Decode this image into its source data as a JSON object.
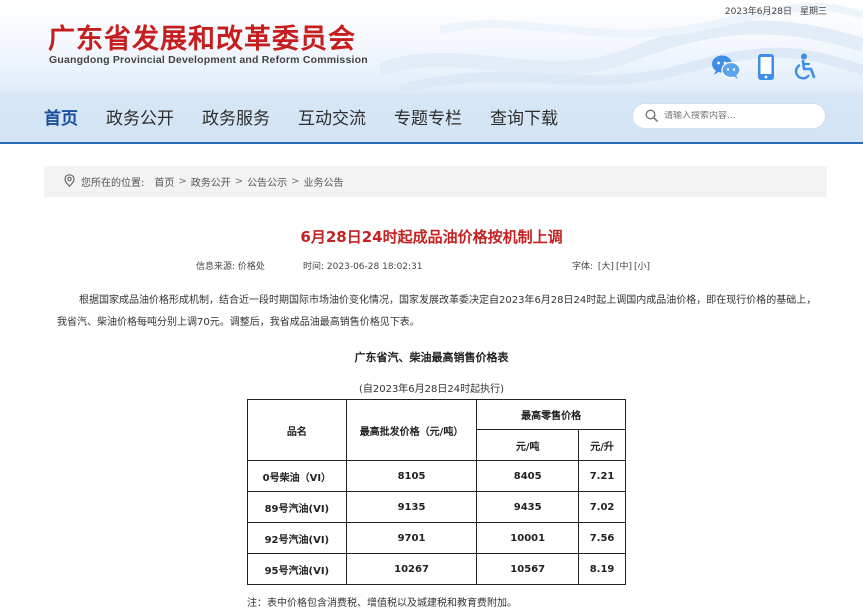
{
  "header": {
    "date": "2023年6月28日",
    "weekday": "星期三",
    "title_cn": "广东省发展和改革委员会",
    "title_en": "Guangdong Provincial Development and Reform Commission",
    "icons": [
      "wechat-icon",
      "mobile-icon",
      "accessibility-icon"
    ]
  },
  "nav": {
    "items": [
      "首页",
      "政务公开",
      "政务服务",
      "互动交流",
      "专题专栏",
      "查询下载"
    ],
    "active_index": 0
  },
  "search": {
    "placeholder": "请输入搜索内容..."
  },
  "breadcrumb": {
    "label": "您所在的位置:",
    "items": [
      "首页",
      "政务公开",
      "公告公示",
      "业务公告"
    ]
  },
  "article": {
    "title": "6月28日24时起成品油价格按机制上调",
    "source_label": "信息来源:",
    "source_value": "价格处",
    "time_label": "时间:",
    "time_value": "2023-06-28 18:02:31",
    "font_label": "字体:",
    "font_sizes": [
      "[大]",
      "[中]",
      "[小]"
    ],
    "paragraph": "根据国家成品油价格形成机制，结合近一段时期国际市场油价变化情况，国家发展改革委决定自2023年6月28日24时起上调国内成品油价格，即在现行价格的基础上，我省汽、柴油价格每吨分别上调70元。调整后，我省成品油最高销售价格见下表。",
    "table_title": "广东省汽、柴油最高销售价格表",
    "table_subtitle": "(自2023年6月28日24时起执行)",
    "table": {
      "header": {
        "product": "品名",
        "wholesale": "最高批发价格（元/吨）",
        "retail": "最高零售价格",
        "retail_ton": "元/吨",
        "retail_liter": "元/升"
      },
      "rows": [
        {
          "product": "0号柴油（VI）",
          "wholesale": "8105",
          "retail_ton": "8405",
          "retail_liter": "7.21"
        },
        {
          "product": "89号汽油(VI)",
          "wholesale": "9135",
          "retail_ton": "9435",
          "retail_liter": "7.02"
        },
        {
          "product": "92号汽油(VI)",
          "wholesale": "9701",
          "retail_ton": "10001",
          "retail_liter": "7.56"
        },
        {
          "product": "95号汽油(VI)",
          "wholesale": "10267",
          "retail_ton": "10567",
          "retail_liter": "8.19"
        }
      ]
    },
    "note": "注：表中价格包含消费税、增值税以及城建税和教育费附加。"
  },
  "colors": {
    "title_red": "#c61e1e",
    "nav_active": "#1a4e9b",
    "header_line": "#2b6cb5",
    "icon_blue": "#3f8ee6"
  }
}
